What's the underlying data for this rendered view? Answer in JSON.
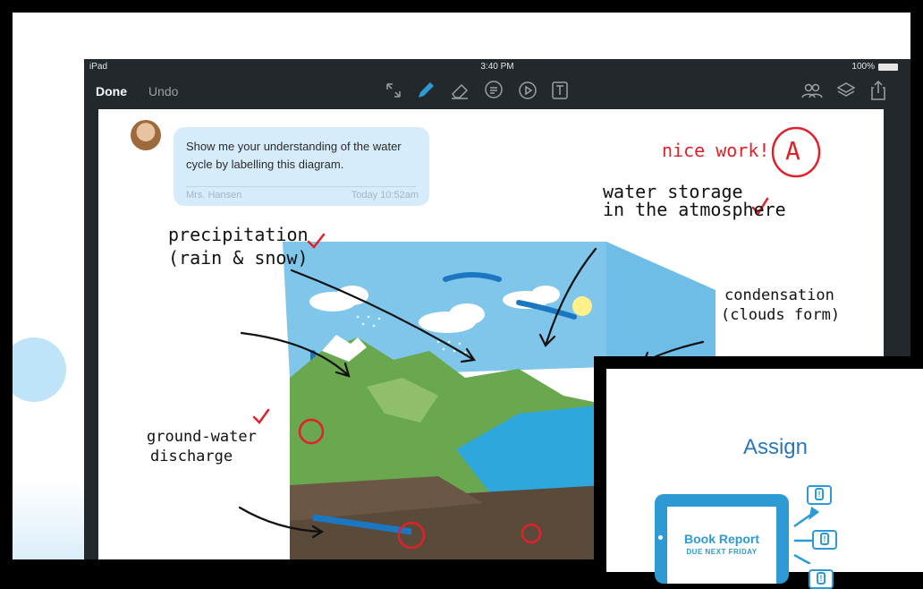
{
  "status_bar": {
    "device": "iPad",
    "time": "3:40 PM",
    "battery": "100%"
  },
  "toolbar": {
    "done_label": "Done",
    "undo_label": "Undo",
    "icons": [
      "expand-icon",
      "pencil-icon",
      "eraser-icon",
      "comment-icon",
      "play-icon",
      "text-tool-icon",
      "people-icon",
      "layers-icon",
      "share-icon"
    ]
  },
  "comment": {
    "text": "Show me your understanding of the water cycle by labelling this diagram.",
    "author": "Mrs. Hansen",
    "time": "Today 10:52am"
  },
  "annotations": {
    "grade_note": "nice work!",
    "grade": "A",
    "precipitation_1": "precipitation",
    "precipitation_2": "(rain & snow)",
    "storage_1": "water storage",
    "storage_2": "in the atmosphere",
    "condensation_1": "condensation",
    "condensation_2": "(clouds form)",
    "groundwater_1": "ground-water",
    "groundwater_2": "discharge"
  },
  "assign_card": {
    "title": "Assign",
    "book_title": "Book Report",
    "book_due": "DUE NEXT FRIDAY"
  },
  "colors": {
    "accent": "#2d9ad3",
    "bubble": "#d7ecfb",
    "ink_red": "#e2202a",
    "toolbar": "#23282d"
  }
}
